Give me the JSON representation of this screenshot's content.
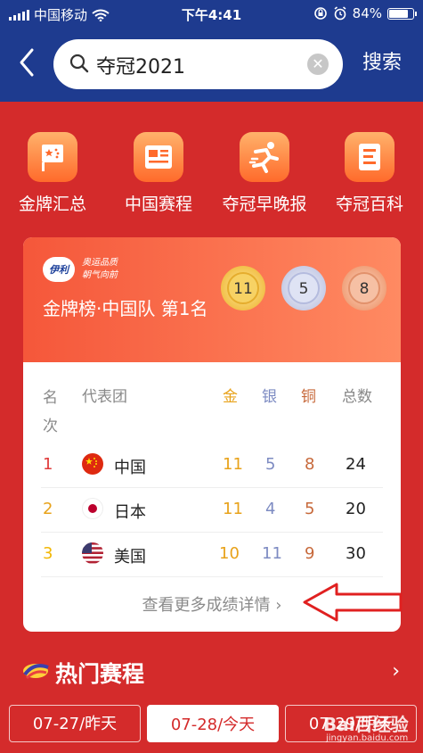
{
  "status_bar": {
    "carrier": "中国移动",
    "time": "下午4:41",
    "battery_percent": "84%",
    "battery_level": 0.84
  },
  "search": {
    "query": "夺冠2021",
    "search_button": "搜索"
  },
  "quick_nav": [
    {
      "label": "金牌汇总",
      "icon": "star-flag-icon"
    },
    {
      "label": "中国赛程",
      "icon": "schedule-card-icon"
    },
    {
      "label": "夺冠早晚报",
      "icon": "runner-icon"
    },
    {
      "label": "夺冠百科",
      "icon": "book-icon"
    }
  ],
  "medal_card": {
    "brand_name": "伊利",
    "slogan_line1": "奥运品质",
    "slogan_line2": "朝气向前",
    "title": "金牌榜·中国队 第1名",
    "gold": "11",
    "silver": "5",
    "bronze": "8",
    "headers": {
      "rank": "名次",
      "team": "代表团",
      "gold": "金",
      "silver": "银",
      "bronze": "铜",
      "total": "总数"
    },
    "rows": [
      {
        "rank": "1",
        "team": "中国",
        "gold": "11",
        "silver": "5",
        "bronze": "8",
        "total": "24",
        "flag": "china-flag-icon"
      },
      {
        "rank": "2",
        "team": "日本",
        "gold": "11",
        "silver": "4",
        "bronze": "5",
        "total": "20",
        "flag": "japan-flag-icon"
      },
      {
        "rank": "3",
        "team": "美国",
        "gold": "10",
        "silver": "11",
        "bronze": "9",
        "total": "30",
        "flag": "usa-flag-icon"
      }
    ],
    "more_link": "查看更多成绩详情"
  },
  "hot_events": {
    "title": "热门赛程"
  },
  "dates": [
    {
      "label": "07-27/昨天",
      "active": false
    },
    {
      "label": "07-28/今天",
      "active": true
    },
    {
      "label": "07-29/明天",
      "active": false
    }
  ],
  "watermark": {
    "text": "Bai百经验",
    "url": "jingyan.baidu.com"
  },
  "colors": {
    "nav_blue": "#1e3b8f",
    "page_red": "#d42b2b",
    "gold_text": "#e8a21a",
    "silver_text": "#7d8bc2",
    "bronze_text": "#c7693b"
  }
}
